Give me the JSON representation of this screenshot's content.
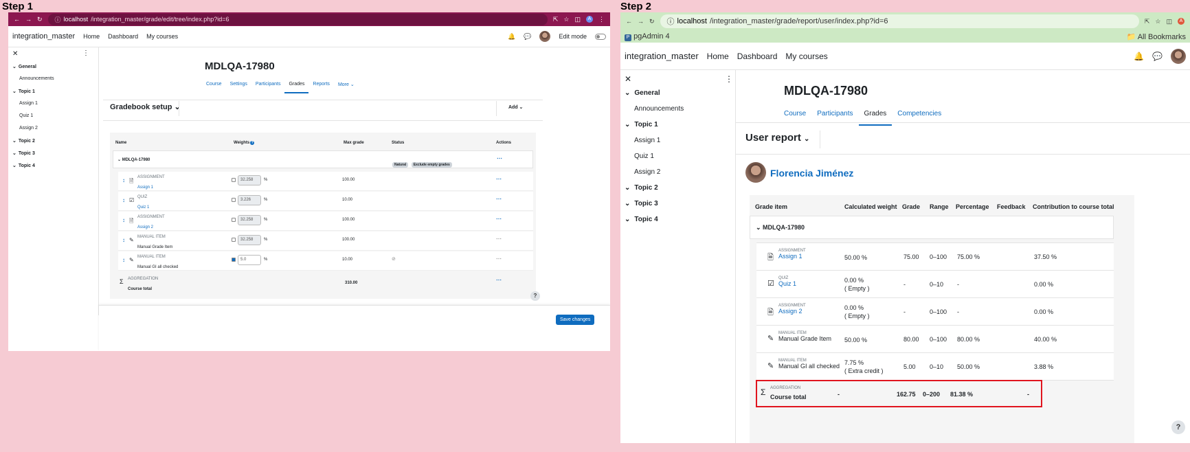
{
  "step1": {
    "label": "Step 1",
    "url_host": "localhost",
    "url_path": "/integration_master/grade/edit/tree/index.php?id=6",
    "brand": "integration_master",
    "nav": [
      "Home",
      "Dashboard",
      "My courses"
    ],
    "edit_mode": "Edit mode",
    "course_title": "MDLQA-17980",
    "tabs": [
      "Course",
      "Settings",
      "Participants",
      "Grades",
      "Reports",
      "More"
    ],
    "active_tab": "Grades",
    "page_heading": "Gradebook setup",
    "add_label": "Add",
    "drawer": [
      {
        "label": "General",
        "type": "section"
      },
      {
        "label": "Announcements",
        "type": "item"
      },
      {
        "label": "Topic 1",
        "type": "section"
      },
      {
        "label": "Assign 1",
        "type": "item"
      },
      {
        "label": "Quiz 1",
        "type": "item"
      },
      {
        "label": "Assign 2",
        "type": "item"
      },
      {
        "label": "Topic 2",
        "type": "section"
      },
      {
        "label": "Topic 3",
        "type": "section"
      },
      {
        "label": "Topic 4",
        "type": "section"
      }
    ],
    "columns": [
      "Name",
      "Weights",
      "Max grade",
      "Status",
      "Actions"
    ],
    "category": {
      "name": "MDLQA-17980",
      "badges": [
        "Natural",
        "Exclude empty grades"
      ]
    },
    "rows": [
      {
        "type": "ASSIGNMENT",
        "name": "Assign 1",
        "weight": "32.258",
        "checked": false,
        "max": "100.00"
      },
      {
        "type": "QUIZ",
        "name": "Quiz 1",
        "weight": "3.226",
        "checked": false,
        "max": "10.00"
      },
      {
        "type": "ASSIGNMENT",
        "name": "Assign 2",
        "weight": "32.258",
        "checked": false,
        "max": "100.00"
      },
      {
        "type": "MANUAL ITEM",
        "name": "Manual Grade Item",
        "weight": "32.258",
        "checked": false,
        "max": "100.00"
      },
      {
        "type": "MANUAL ITEM",
        "name": "Manual GI all checked",
        "weight": "5.0",
        "checked": true,
        "max": "10.00"
      }
    ],
    "total": {
      "type": "AGGREGATION",
      "name": "Course total",
      "max": "310.00"
    },
    "save_label": "Save changes",
    "help": "?"
  },
  "step2": {
    "label": "Step 2",
    "url_host": "localhost",
    "url_path": "/integration_master/grade/report/user/index.php?id=6",
    "bookmark": "pgAdmin 4",
    "all_bookmarks": "All Bookmarks",
    "brand": "integration_master",
    "nav": [
      "Home",
      "Dashboard",
      "My courses"
    ],
    "course_title": "MDLQA-17980",
    "tabs": [
      "Course",
      "Participants",
      "Grades",
      "Competencies"
    ],
    "active_tab": "Grades",
    "page_heading": "User report",
    "user_name": "Florencia Jiménez",
    "drawer": [
      {
        "label": "General",
        "type": "section"
      },
      {
        "label": "Announcements",
        "type": "item"
      },
      {
        "label": "Topic 1",
        "type": "section"
      },
      {
        "label": "Assign 1",
        "type": "item"
      },
      {
        "label": "Quiz 1",
        "type": "item"
      },
      {
        "label": "Assign 2",
        "type": "item"
      },
      {
        "label": "Topic 2",
        "type": "section"
      },
      {
        "label": "Topic 3",
        "type": "section"
      },
      {
        "label": "Topic 4",
        "type": "section"
      }
    ],
    "columns": [
      "Grade item",
      "Calculated weight",
      "Grade",
      "Range",
      "Percentage",
      "Feedback",
      "Contribution to course total"
    ],
    "category": "MDLQA-17980",
    "rows": [
      {
        "type": "ASSIGNMENT",
        "name": "Assign 1",
        "weight": "50.00 %",
        "weight_note": "",
        "grade": "75.00",
        "range": "0–100",
        "pct": "75.00 %",
        "contrib": "37.50 %",
        "link": true
      },
      {
        "type": "QUIZ",
        "name": "Quiz 1",
        "weight": "0.00 %",
        "weight_note": "( Empty )",
        "grade": "-",
        "range": "0–10",
        "pct": "-",
        "contrib": "0.00 %",
        "link": true
      },
      {
        "type": "ASSIGNMENT",
        "name": "Assign 2",
        "weight": "0.00 %",
        "weight_note": "( Empty )",
        "grade": "-",
        "range": "0–100",
        "pct": "-",
        "contrib": "0.00 %",
        "link": true
      },
      {
        "type": "MANUAL ITEM",
        "name": "Manual Grade Item",
        "weight": "50.00 %",
        "weight_note": "",
        "grade": "80.00",
        "range": "0–100",
        "pct": "80.00 %",
        "contrib": "40.00 %",
        "link": false
      },
      {
        "type": "MANUAL ITEM",
        "name": "Manual GI all checked",
        "weight": "7.75 %",
        "weight_note": "( Extra credit )",
        "grade": "5.00",
        "range": "0–10",
        "pct": "50.00 %",
        "contrib": "3.88 %",
        "link": false
      }
    ],
    "total": {
      "type": "AGGREGATION",
      "name": "Course total",
      "weight": "-",
      "grade": "162.75",
      "range": "0–200",
      "pct": "81.38 %",
      "contrib": "-"
    },
    "help": "?"
  },
  "colors": {
    "accent": "#0f6cbf",
    "chrome1": "#8c1750",
    "chrome2": "#cde9c4",
    "highlight": "#e0141e",
    "background": "#f6cbd3"
  }
}
